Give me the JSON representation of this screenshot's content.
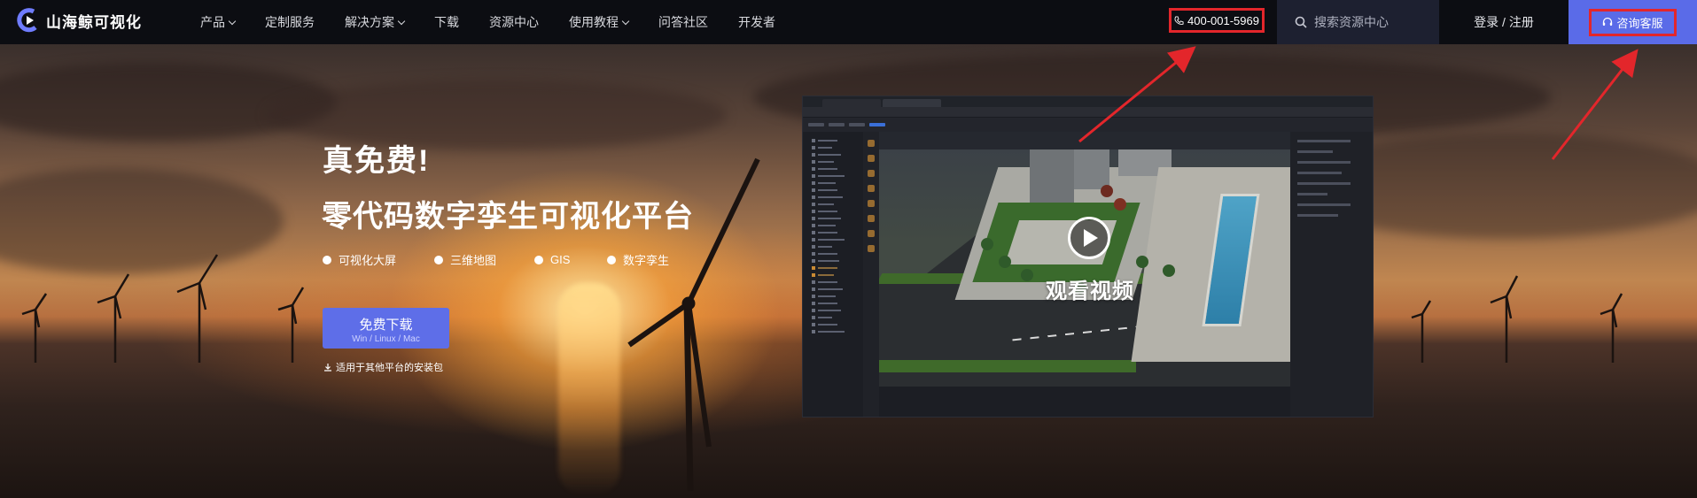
{
  "brand": {
    "name": "山海鲸可视化"
  },
  "nav": {
    "items": [
      {
        "label": "产品",
        "dropdown": true
      },
      {
        "label": "定制服务",
        "dropdown": false
      },
      {
        "label": "解决方案",
        "dropdown": true
      },
      {
        "label": "下载",
        "dropdown": false
      },
      {
        "label": "资源中心",
        "dropdown": false
      },
      {
        "label": "使用教程",
        "dropdown": true
      },
      {
        "label": "问答社区",
        "dropdown": false
      },
      {
        "label": "开发者",
        "dropdown": false
      }
    ],
    "phone": "400-001-5969",
    "search_placeholder": "搜索资源中心",
    "login": "登录 / 注册",
    "consult": "咨询客服"
  },
  "hero": {
    "title": "真免费!",
    "subtitle": "零代码数字孪生可视化平台",
    "features": [
      "可视化大屏",
      "三维地图",
      "GIS",
      "数字孪生"
    ],
    "download_label": "免费下载",
    "download_platforms": "Win / Linux / Mac",
    "other_platforms": "适用于其他平台的安装包"
  },
  "preview": {
    "video_label": "观看视频"
  },
  "colors": {
    "accent": "#5e6ee8",
    "highlight": "#e3262b",
    "nav_bg": "#0c0d12"
  },
  "icons": [
    "logo-icon",
    "chevron-down-icon",
    "phone-icon",
    "search-icon",
    "headset-icon",
    "download-icon",
    "play-icon"
  ]
}
